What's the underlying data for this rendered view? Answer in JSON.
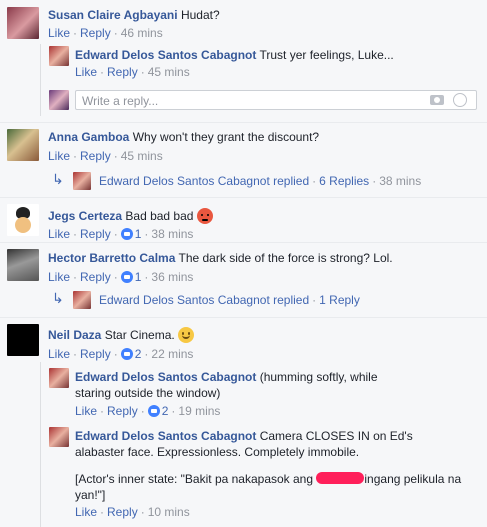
{
  "common": {
    "like": "Like",
    "reply": "Reply",
    "sep": "·"
  },
  "c1": {
    "author": "Susan Claire Agbayani",
    "text": "Hudat?",
    "time": "46 mins",
    "replies": [
      {
        "author": "Edward Delos Santos Cabagnot",
        "text": "Trust yer feelings, Luke...",
        "time": "45 mins"
      }
    ],
    "reply_placeholder": "Write a reply..."
  },
  "c2": {
    "author": "Anna Gamboa",
    "text": "Why won't they grant the discount?",
    "time": "45 mins",
    "thread": {
      "author": "Edward Delos Santos Cabagnot",
      "action": "replied",
      "count": "6 Replies",
      "time": "38 mins"
    }
  },
  "c3": {
    "author": "Jegs Certeza",
    "text": "Bad bad bad",
    "likes": "1",
    "time": "38 mins"
  },
  "c4": {
    "author": "Hector Barretto Calma",
    "text": "The dark side of the force is strong? Lol.",
    "likes": "1",
    "time": "36 mins",
    "thread": {
      "author": "Edward Delos Santos Cabagnot",
      "action": "replied",
      "count": "1 Reply"
    }
  },
  "c5": {
    "author": "Neil Daza",
    "text": "Star Cinema.",
    "likes": "2",
    "time": "22 mins",
    "replies": [
      {
        "author": "Edward Delos Santos Cabagnot",
        "text": "(humming softly, while staring outside the window)",
        "likes": "2",
        "time": "19 mins"
      },
      {
        "author": "Edward Delos Santos Cabagnot",
        "text": "Camera CLOSES IN on Ed's alabaster face. Expressionless. Completely immobile.",
        "extra_pre": "[Actor's inner state: \"Bakit pa nakapasok ang",
        "extra_post": "ingang pelikula na yan!\"]",
        "time": "10 mins"
      }
    ]
  },
  "colors": {
    "link": "#4267b2",
    "name": "#365899",
    "like_blue": "#4080ff",
    "redaction": "#ff1f5a"
  }
}
